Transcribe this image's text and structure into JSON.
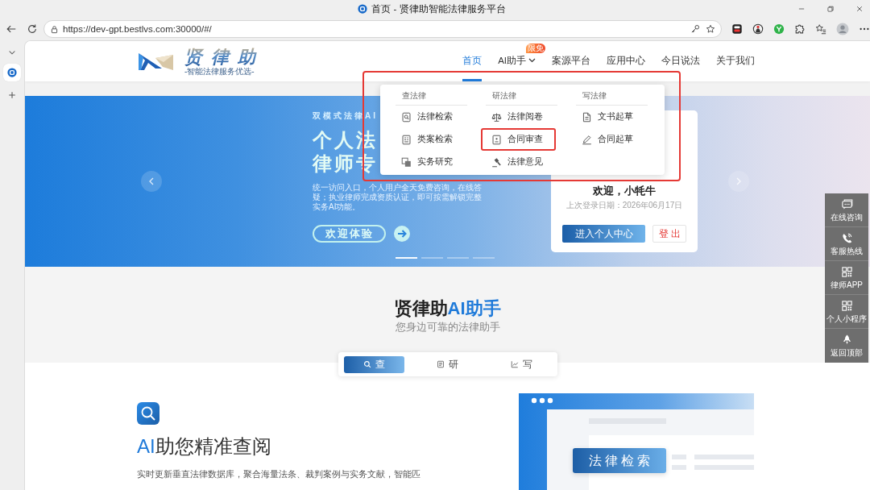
{
  "browser": {
    "tab_title": "首页 - 贤律助智能法律服务平台",
    "url": "https://dev-gpt.bestlvs.com:30000/#/"
  },
  "header": {
    "logo_name": "贤律助",
    "logo_tagline": "-智能法律服务优选-",
    "nav": [
      {
        "label": "首页",
        "selected": true,
        "caret": false
      },
      {
        "label": "AI助手",
        "selected": false,
        "caret": true,
        "badge": "限免"
      },
      {
        "label": "案源平台",
        "selected": false,
        "caret": false
      },
      {
        "label": "应用中心",
        "selected": false,
        "caret": false
      },
      {
        "label": "今日说法",
        "selected": false,
        "caret": false
      },
      {
        "label": "关于我们",
        "selected": false,
        "caret": false
      }
    ]
  },
  "dropdown": {
    "annotated": true,
    "columns": [
      {
        "heading": "查法律",
        "items": [
          {
            "label": "法律检索",
            "annotated": false
          },
          {
            "label": "类案检索",
            "annotated": false
          },
          {
            "label": "实务研究",
            "annotated": false
          }
        ]
      },
      {
        "heading": "研法律",
        "items": [
          {
            "label": "法律阅卷",
            "annotated": false
          },
          {
            "label": "合同审查",
            "annotated": true
          },
          {
            "label": "法律意见",
            "annotated": false
          }
        ]
      },
      {
        "heading": "写法律",
        "items": [
          {
            "label": "文书起草",
            "annotated": false
          },
          {
            "label": "合同起草",
            "annotated": false
          }
        ]
      }
    ]
  },
  "hero": {
    "eyebrow": "双模式法律AI",
    "headline": [
      "个人法",
      "律师专"
    ],
    "text": "统一访问入口，个人用户全天免费咨询，在线答疑；执业律师完成资质认证，即可按需解锁完整实务AI功能。",
    "cta": "欢迎体验",
    "slides": [
      {
        "selected": true
      },
      {
        "selected": false
      },
      {
        "selected": false
      },
      {
        "selected": false
      }
    ]
  },
  "welcome_card": {
    "greeting": "欢迎，小牦牛",
    "last_login": "上次登录日期：2026年06月17日",
    "primary_button": "进入个人中心",
    "logout_button": "登出"
  },
  "assistant_section": {
    "title": "贤律助",
    "title_accent": "AI助手",
    "subtitle": "您身边可靠的法律助手",
    "tabs": [
      {
        "label": "查",
        "selected": true
      },
      {
        "label": "研",
        "selected": false
      },
      {
        "label": "写",
        "selected": false
      }
    ]
  },
  "feature": {
    "heading_accent": "AI",
    "heading": "助您精准查阅",
    "text": "实时更新垂直法律数据库，聚合海量法条、裁判案例与实务文献，智能匹",
    "illustration_label": "法律检索"
  },
  "side_tools": [
    {
      "label": "在线咨询"
    },
    {
      "label": "客服热线"
    },
    {
      "label": "律师APP"
    },
    {
      "label": "个人小程序"
    },
    {
      "label": "返回顶部"
    }
  ]
}
